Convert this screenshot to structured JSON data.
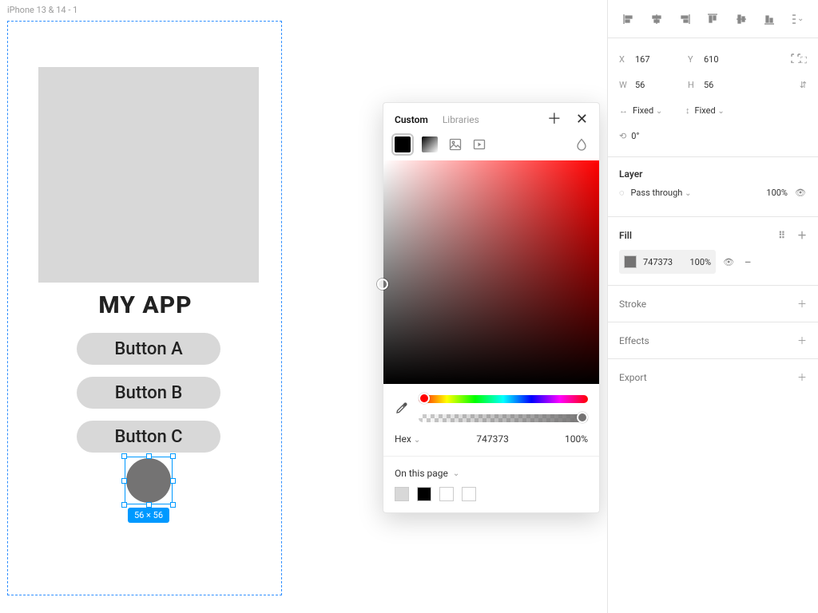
{
  "canvas": {
    "frame_label": "iPhone 13 & 14 - 1",
    "app_title": "MY APP",
    "buttons": [
      "Button A",
      "Button B",
      "Button C"
    ],
    "selection_badge": "56 × 56",
    "selected_fill": "#747373"
  },
  "picker": {
    "tab_custom": "Custom",
    "tab_libraries": "Libraries",
    "format_label": "Hex",
    "hex_value": "747373",
    "alpha_value": "100%",
    "on_page_label": "On this page",
    "swatches": [
      "#d8d8d8",
      "#000000",
      "#ffffff",
      "#ffffff"
    ]
  },
  "inspector": {
    "x_label": "X",
    "x_value": "167",
    "y_label": "Y",
    "y_value": "610",
    "w_label": "W",
    "w_value": "56",
    "h_label": "H",
    "h_value": "56",
    "horiz_constraint": "Fixed",
    "vert_constraint": "Fixed",
    "rotation": "0°",
    "layer_heading": "Layer",
    "blend_mode": "Pass through",
    "layer_opacity": "100%",
    "fill_heading": "Fill",
    "fill_hex": "747373",
    "fill_opacity": "100%",
    "stroke_heading": "Stroke",
    "effects_heading": "Effects",
    "export_heading": "Export"
  }
}
